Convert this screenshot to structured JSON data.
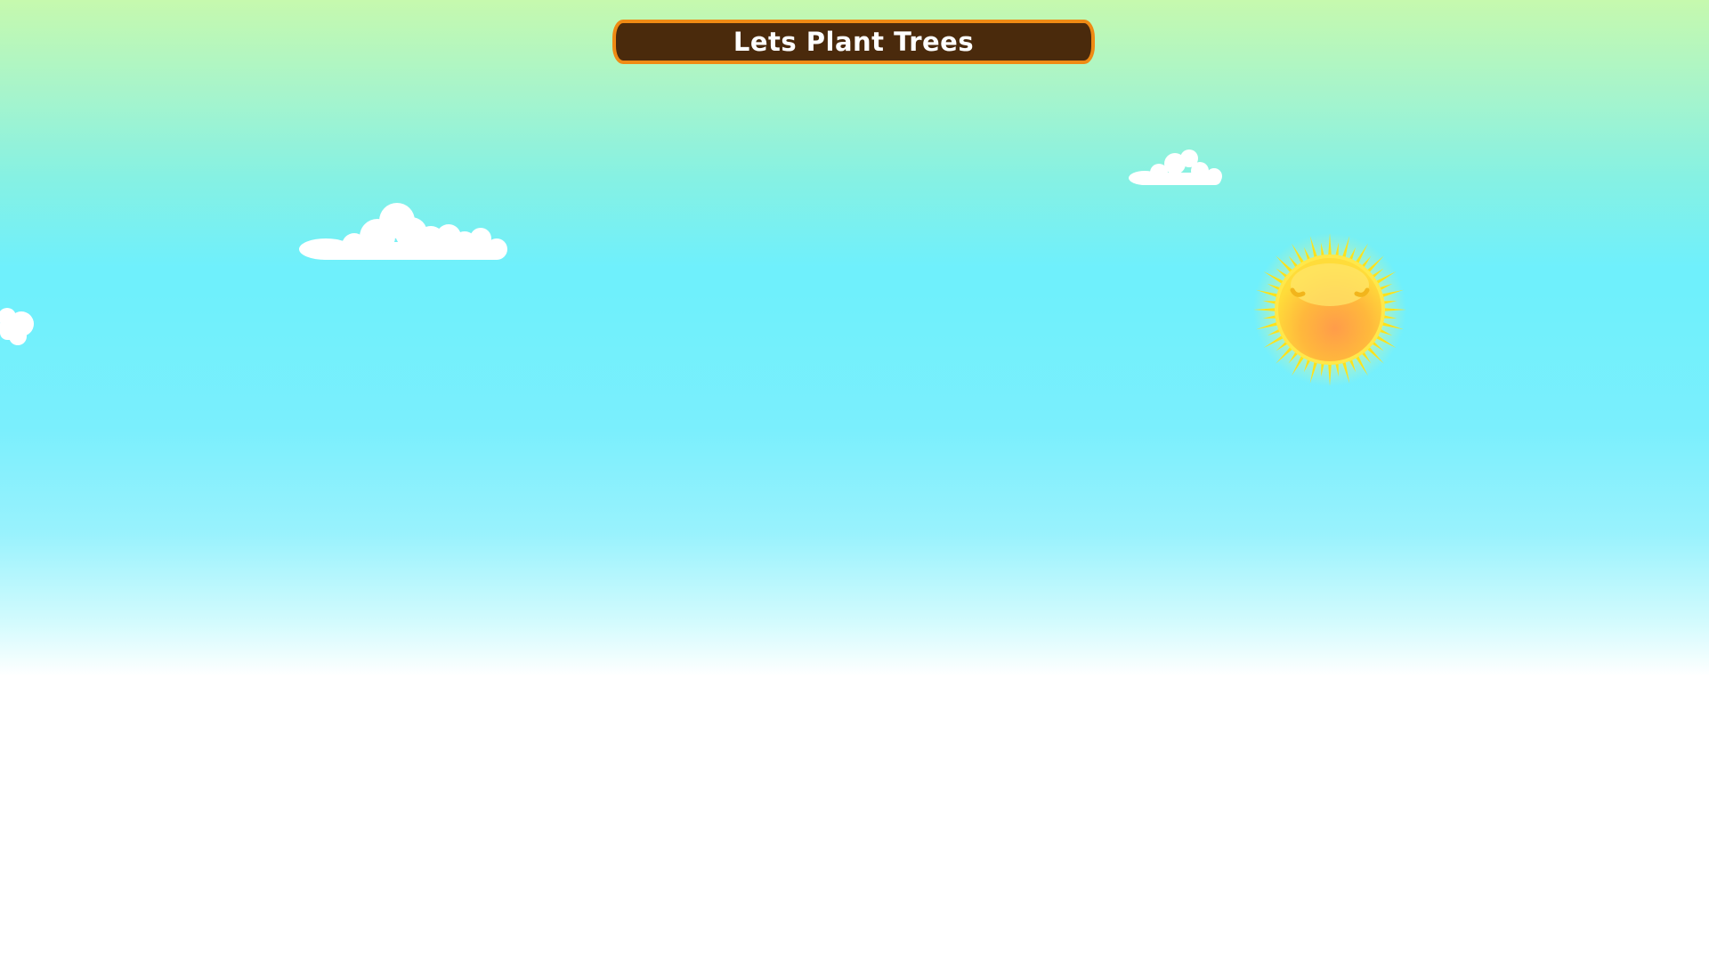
{
  "game": {
    "title": "Lets Plant Trees"
  },
  "scene": {
    "sky_colors": {
      "top": "#c6f9ae",
      "middle": "#6ff0fc",
      "bottom": "#ffffff"
    },
    "banner_colors": {
      "fill": "#4a2a0c",
      "border": "#ef8a14",
      "text": "#ffffff"
    },
    "sun_colors": {
      "rays": "#ffe21a",
      "core": "#ffb23a",
      "highlight": "#ffe766"
    },
    "cloud_color": "#ffffff",
    "elements": [
      "sun-icon",
      "cloud-icon",
      "cloud-icon",
      "cloud-icon"
    ]
  }
}
